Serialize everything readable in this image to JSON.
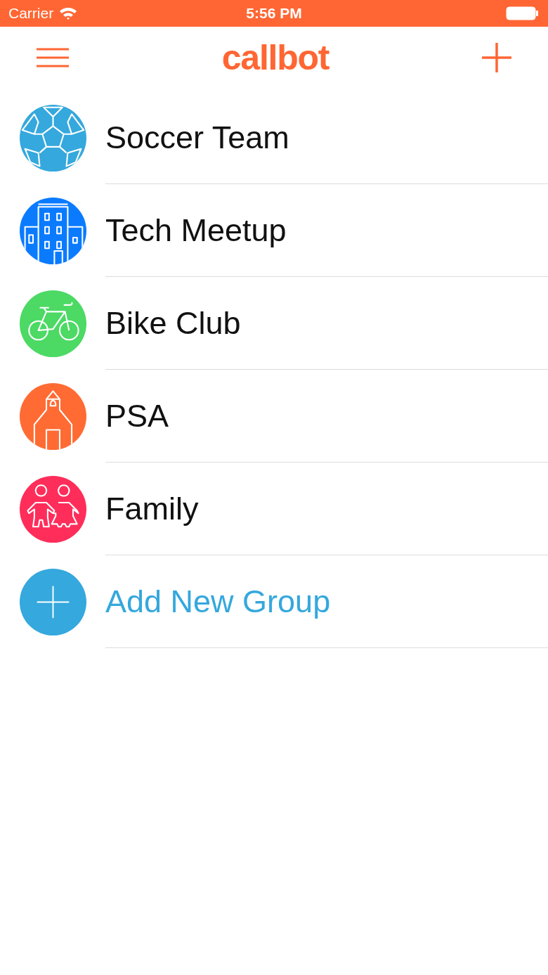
{
  "status_bar": {
    "carrier": "Carrier",
    "time": "5:56 PM"
  },
  "nav_bar": {
    "title": "callbot"
  },
  "groups": [
    {
      "kind": "soccer",
      "name": "Soccer Team",
      "color": "#35a8dd"
    },
    {
      "kind": "building",
      "name": "Tech Meetup",
      "color": "#0a7bff"
    },
    {
      "kind": "bike",
      "name": "Bike Club",
      "color": "#4cd964"
    },
    {
      "kind": "school",
      "name": "PSA",
      "color": "#ff6b33"
    },
    {
      "kind": "family",
      "name": "Family",
      "color": "#ff2d5a"
    },
    {
      "kind": "add",
      "name": "Add New Group",
      "color": "#35a8dd"
    }
  ]
}
